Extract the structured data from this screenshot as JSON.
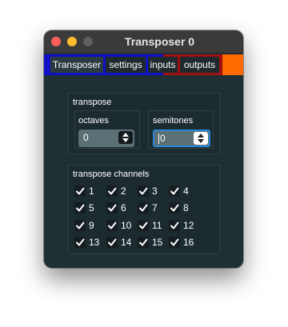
{
  "window": {
    "title": "Transposer 0",
    "close_icon": "close-icon",
    "minimize_icon": "minimize-icon",
    "maximize_icon": "maximize-icon"
  },
  "tabs": [
    {
      "label": "Transposer",
      "active": true
    },
    {
      "label": "settings",
      "active": false
    },
    {
      "label": "inputs",
      "active": false
    },
    {
      "label": "outputs",
      "active": false
    }
  ],
  "tab_colors": {
    "object": "#1010c8",
    "inputs": "#a10f12",
    "outputs": "#ff6a00"
  },
  "transpose": {
    "section_label": "transpose",
    "octaves": {
      "label": "octaves",
      "value": "0"
    },
    "semitones": {
      "label": "semitones",
      "value": "0",
      "focused": true
    }
  },
  "channels": {
    "section_label": "transpose channels",
    "items": [
      {
        "label": "1",
        "checked": true
      },
      {
        "label": "2",
        "checked": true
      },
      {
        "label": "3",
        "checked": true
      },
      {
        "label": "4",
        "checked": true
      },
      {
        "label": "5",
        "checked": true
      },
      {
        "label": "6",
        "checked": true
      },
      {
        "label": "7",
        "checked": true
      },
      {
        "label": "8",
        "checked": true
      },
      {
        "label": "9",
        "checked": true
      },
      {
        "label": "10",
        "checked": true
      },
      {
        "label": "11",
        "checked": true
      },
      {
        "label": "12",
        "checked": true
      },
      {
        "label": "13",
        "checked": true
      },
      {
        "label": "14",
        "checked": true
      },
      {
        "label": "15",
        "checked": true
      },
      {
        "label": "16",
        "checked": true
      }
    ]
  }
}
